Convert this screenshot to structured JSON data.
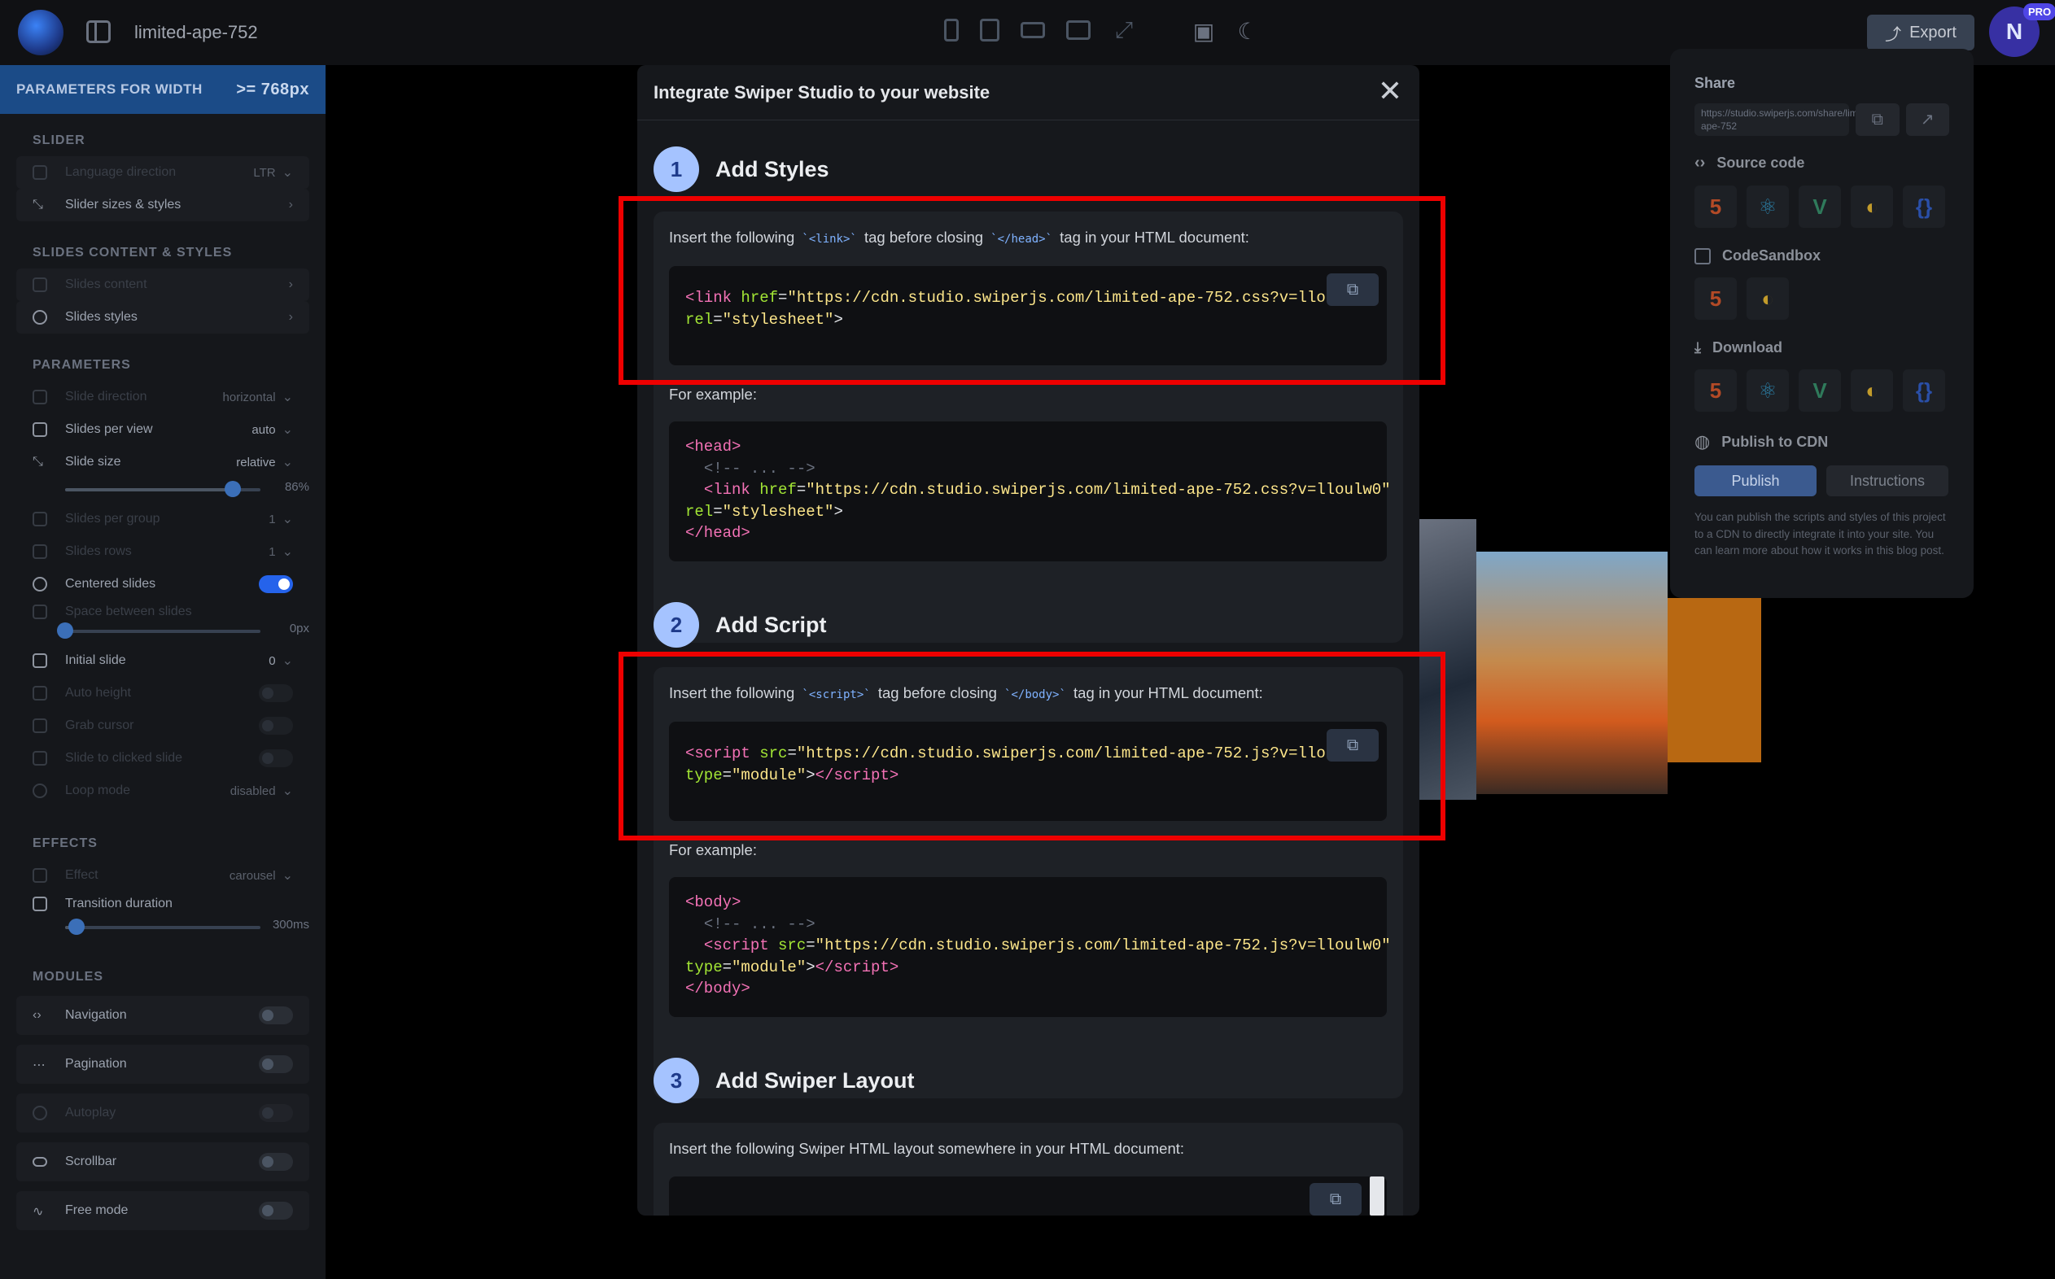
{
  "topbar": {
    "project_name": "limited-ape-752",
    "export_label": "Export",
    "avatar_initial": "N",
    "badge": "PRO"
  },
  "left_panel": {
    "header_label": "PARAMETERS FOR WIDTH",
    "breakpoint": ">= 768px",
    "sections": {
      "slider": "SLIDER",
      "slides_content": "SLIDES CONTENT & STYLES",
      "parameters": "PARAMETERS",
      "effects": "EFFECTS",
      "modules": "MODULES"
    },
    "items": {
      "language_direction": "Language direction",
      "language_direction_value": "LTR",
      "slider_sizes": "Slider sizes & styles",
      "slides_content": "Slides content",
      "slides_styles": "Slides styles",
      "slide_direction": "Slide direction",
      "slide_direction_value": "horizontal",
      "slides_per_view": "Slides per view",
      "slides_per_view_value": "auto",
      "slide_size": "Slide size",
      "slide_size_value": "relative",
      "slide_size_percent": "86%",
      "slides_per_group": "Slides per group",
      "slides_per_group_value": "1",
      "slides_rows": "Slides rows",
      "slides_rows_value": "1",
      "centered_slides": "Centered slides",
      "space_between": "Space between slides",
      "space_between_value": "0px",
      "initial_slide": "Initial slide",
      "initial_slide_value": "0",
      "auto_height": "Auto height",
      "grab_cursor": "Grab cursor",
      "slide_to_clicked": "Slide to clicked slide",
      "loop_mode": "Loop mode",
      "loop_mode_value": "disabled",
      "effect": "Effect",
      "effect_value": "carousel",
      "transition_duration": "Transition duration",
      "transition_duration_value": "300ms",
      "navigation": "Navigation",
      "pagination": "Pagination",
      "autoplay": "Autoplay",
      "scrollbar": "Scrollbar",
      "free_mode": "Free mode"
    },
    "slide_size_fraction": 0.86,
    "transition_fraction": 0.06,
    "space_between_fraction": 0.0
  },
  "right_panel": {
    "share_title": "Share",
    "share_url": "https://studio.swiperjs.com/share/limited-ape-752",
    "source_code": "Source code",
    "codesandbox": "CodeSandbox",
    "download": "Download",
    "publish_cdn": "Publish to CDN",
    "publish_btn": "Publish",
    "instructions_btn": "Instructions",
    "note": "You can publish the scripts and styles of this project to a CDN to directly integrate it into your site. You can learn more about how it works in this blog post."
  },
  "modal": {
    "title": "Integrate Swiper Studio to your website",
    "step1": {
      "num": "1",
      "title": "Add Styles",
      "instr_a": "Insert the following ",
      "instr_code1": "`<link>`",
      "instr_b": " tag before closing ",
      "instr_code2": "`</head>`",
      "instr_c": " tag in your HTML document:",
      "example_label": "For example:"
    },
    "step2": {
      "num": "2",
      "title": "Add Script",
      "instr_a": "Insert the following ",
      "instr_code1": "`<script>`",
      "instr_b": " tag before closing ",
      "instr_code2": "`</body>`",
      "instr_c": " tag in your HTML document:",
      "example_label": "For example:"
    },
    "step3": {
      "num": "3",
      "title": "Add Swiper Layout",
      "instr": "Insert the following Swiper HTML layout somewhere in your HTML document:"
    },
    "code": {
      "css_url": "https://cdn.studio.swiperjs.com/limited-ape-752.css?v=lloulw0",
      "js_url": "https://cdn.studio.swiperjs.com/limited-ape-752.js?v=lloulw0",
      "comment": "<!-- ... -->"
    }
  },
  "colors": {
    "highlight": "#e00000",
    "accent": "#2563eb",
    "step_badge": "#a5c3ff"
  }
}
